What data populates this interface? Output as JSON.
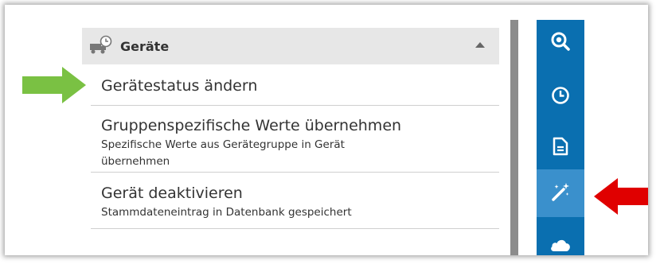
{
  "section": {
    "title": "Geräte",
    "icon": "truck-clock-icon",
    "collapse_icon": "caret-up-icon"
  },
  "actions": [
    {
      "title": "Gerätestatus ändern"
    },
    {
      "title": "Gruppenspezifische Werte übernehmen",
      "subtitle": "Spezifische Werte aus Gerätegruppe in Gerät übernehmen"
    },
    {
      "title": "Gerät deaktivieren",
      "subtitle": "Stammdateneintrag in Datenbank gespeichert"
    }
  ],
  "toolbar": {
    "buttons": [
      {
        "icon": "search-icon"
      },
      {
        "icon": "clock-icon"
      },
      {
        "icon": "document-icon"
      },
      {
        "icon": "magic-wand-icon",
        "active": true
      },
      {
        "icon": "cloud-icon"
      }
    ]
  },
  "colors": {
    "toolbar_bg": "#0a6fb0",
    "toolbar_active": "#3a90cc",
    "header_bg": "#e7e7e7",
    "green_arrow": "#7ac143",
    "red_arrow": "#e00000"
  }
}
